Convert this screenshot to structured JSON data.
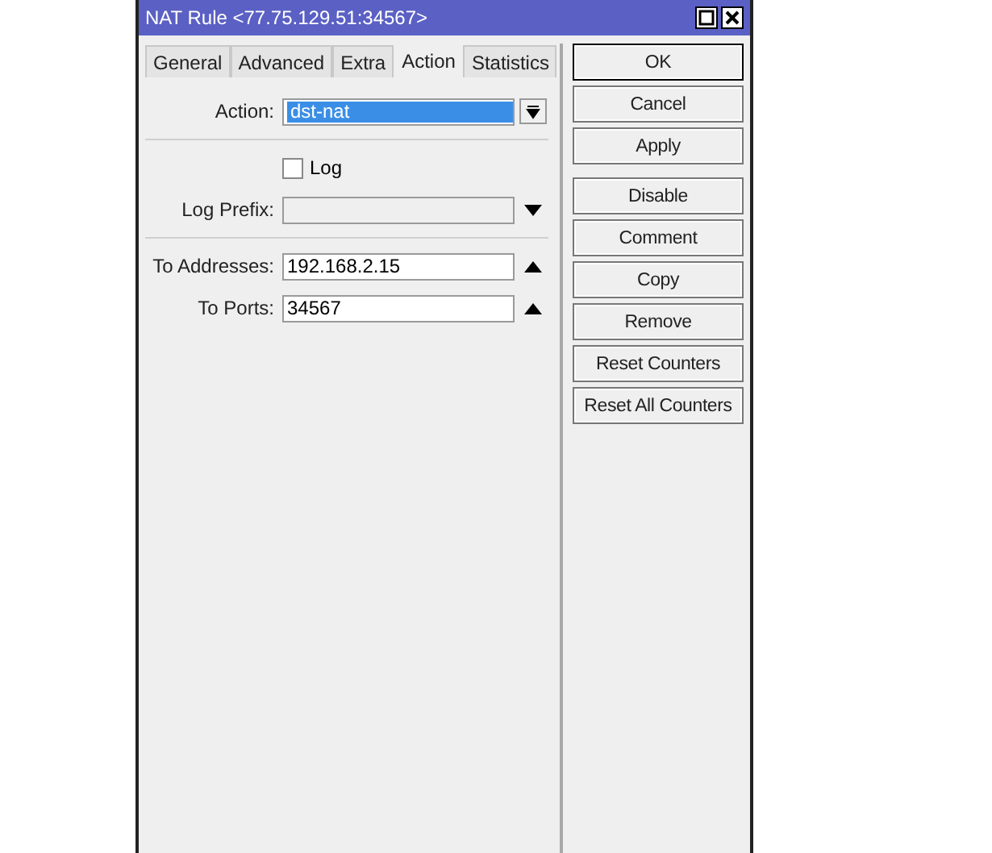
{
  "window": {
    "title": "NAT Rule <77.75.129.51:34567>"
  },
  "tabs": [
    {
      "label": "General",
      "selected": false
    },
    {
      "label": "Advanced",
      "selected": false
    },
    {
      "label": "Extra",
      "selected": false
    },
    {
      "label": "Action",
      "selected": true
    },
    {
      "label": "Statistics",
      "selected": false
    }
  ],
  "form": [
    {
      "kind": "select",
      "label": "Action:",
      "value": "dst-nat",
      "focused": true
    },
    {
      "kind": "separator"
    },
    {
      "kind": "checkbox",
      "label": "Log",
      "checked": false
    },
    {
      "kind": "dropdown",
      "label": "Log Prefix:",
      "disabled": true
    },
    {
      "kind": "separator"
    },
    {
      "kind": "expandable",
      "label": "To Addresses:",
      "value": "192.168.2.15"
    },
    {
      "kind": "expandable",
      "label": "To Ports:",
      "value": "34567"
    }
  ],
  "button_groups": [
    [
      "OK",
      "Cancel",
      "Apply"
    ],
    [
      "Disable",
      "Comment",
      "Copy",
      "Remove",
      "Reset Counters",
      "Reset All Counters"
    ]
  ]
}
